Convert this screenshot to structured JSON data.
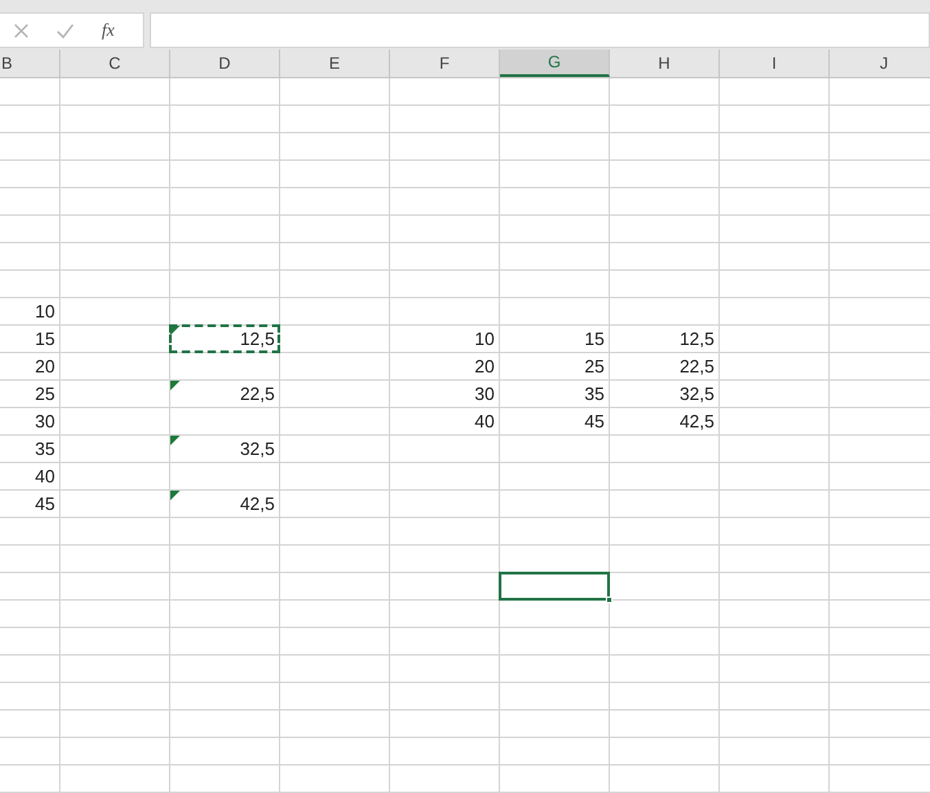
{
  "formula_bar": {
    "function_label": "fx"
  },
  "columns": [
    {
      "label": "B",
      "selected": false
    },
    {
      "label": "C",
      "selected": false
    },
    {
      "label": "D",
      "selected": false
    },
    {
      "label": "E",
      "selected": false
    },
    {
      "label": "F",
      "selected": false
    },
    {
      "label": "G",
      "selected": true
    },
    {
      "label": "H",
      "selected": false
    },
    {
      "label": "I",
      "selected": false
    },
    {
      "label": "J",
      "selected": false
    }
  ],
  "rows": [
    [
      {
        "selected": false
      },
      {
        "selected": false
      },
      {
        "selected": false
      },
      {
        "selected": false
      },
      {
        "selected": false
      },
      {
        "selected": false
      },
      {
        "selected": false
      },
      {
        "selected": false
      },
      {
        "selected": false
      }
    ],
    [
      {
        "selected": false
      },
      {
        "selected": false
      },
      {
        "selected": false
      },
      {
        "selected": false
      },
      {
        "selected": false
      },
      {
        "selected": false
      },
      {
        "selected": false
      },
      {
        "selected": false
      },
      {
        "selected": false
      }
    ],
    [
      {
        "selected": false
      },
      {
        "selected": false
      },
      {
        "selected": false
      },
      {
        "selected": false
      },
      {
        "selected": false
      },
      {
        "selected": false
      },
      {
        "selected": false
      },
      {
        "selected": false
      },
      {
        "selected": false
      }
    ],
    [
      {
        "selected": false
      },
      {
        "selected": false
      },
      {
        "selected": false
      },
      {
        "selected": false
      },
      {
        "selected": false
      },
      {
        "selected": false
      },
      {
        "selected": false
      },
      {
        "selected": false
      },
      {
        "selected": false
      }
    ],
    [
      {
        "selected": false
      },
      {
        "selected": false
      },
      {
        "selected": false
      },
      {
        "selected": false
      },
      {
        "selected": false
      },
      {
        "selected": false
      },
      {
        "selected": false
      },
      {
        "selected": false
      },
      {
        "selected": false
      }
    ],
    [
      {
        "selected": false
      },
      {
        "selected": false
      },
      {
        "selected": false
      },
      {
        "selected": false
      },
      {
        "selected": false
      },
      {
        "selected": false
      },
      {
        "selected": false
      },
      {
        "selected": false
      },
      {
        "selected": false
      }
    ],
    [
      {
        "selected": false
      },
      {
        "selected": false
      },
      {
        "selected": false
      },
      {
        "selected": false
      },
      {
        "selected": false
      },
      {
        "selected": false
      },
      {
        "selected": false
      },
      {
        "selected": false
      },
      {
        "selected": false
      }
    ],
    [
      {
        "selected": false
      },
      {
        "selected": false
      },
      {
        "selected": false
      },
      {
        "selected": false
      },
      {
        "selected": false
      },
      {
        "selected": false
      },
      {
        "selected": false
      },
      {
        "selected": false
      },
      {
        "selected": false
      }
    ],
    [
      {
        "selected": false,
        "value": "10"
      },
      {
        "selected": false
      },
      {
        "selected": false
      },
      {
        "selected": false
      },
      {
        "selected": false
      },
      {
        "selected": false
      },
      {
        "selected": false
      },
      {
        "selected": false
      },
      {
        "selected": false
      }
    ],
    [
      {
        "selected": false,
        "value": "15"
      },
      {
        "selected": false
      },
      {
        "selected": false,
        "value": "12,5",
        "error_flag": true,
        "copy_marquee": true
      },
      {
        "selected": false
      },
      {
        "selected": false,
        "value": "10"
      },
      {
        "selected": false,
        "value": "15"
      },
      {
        "selected": false,
        "value": "12,5"
      },
      {
        "selected": false
      },
      {
        "selected": false
      }
    ],
    [
      {
        "selected": false,
        "value": "20"
      },
      {
        "selected": false
      },
      {
        "selected": false
      },
      {
        "selected": false
      },
      {
        "selected": false,
        "value": "20"
      },
      {
        "selected": false,
        "value": "25"
      },
      {
        "selected": false,
        "value": "22,5"
      },
      {
        "selected": false
      },
      {
        "selected": false
      }
    ],
    [
      {
        "selected": false,
        "value": "25"
      },
      {
        "selected": false
      },
      {
        "selected": false,
        "value": "22,5",
        "error_flag": true
      },
      {
        "selected": false
      },
      {
        "selected": false,
        "value": "30"
      },
      {
        "selected": false,
        "value": "35"
      },
      {
        "selected": false,
        "value": "32,5"
      },
      {
        "selected": false
      },
      {
        "selected": false
      }
    ],
    [
      {
        "selected": false,
        "value": "30"
      },
      {
        "selected": false
      },
      {
        "selected": false
      },
      {
        "selected": false
      },
      {
        "selected": false,
        "value": "40"
      },
      {
        "selected": false,
        "value": "45"
      },
      {
        "selected": false,
        "value": "42,5"
      },
      {
        "selected": false
      },
      {
        "selected": false
      }
    ],
    [
      {
        "selected": false,
        "value": "35"
      },
      {
        "selected": false
      },
      {
        "selected": false,
        "value": "32,5",
        "error_flag": true
      },
      {
        "selected": false
      },
      {
        "selected": false
      },
      {
        "selected": false
      },
      {
        "selected": false
      },
      {
        "selected": false
      },
      {
        "selected": false
      }
    ],
    [
      {
        "selected": false,
        "value": "40"
      },
      {
        "selected": false
      },
      {
        "selected": false
      },
      {
        "selected": false
      },
      {
        "selected": false
      },
      {
        "selected": false
      },
      {
        "selected": false
      },
      {
        "selected": false
      },
      {
        "selected": false
      }
    ],
    [
      {
        "selected": false,
        "value": "45"
      },
      {
        "selected": false
      },
      {
        "selected": false,
        "value": "42,5",
        "error_flag": true
      },
      {
        "selected": false
      },
      {
        "selected": false
      },
      {
        "selected": false
      },
      {
        "selected": false
      },
      {
        "selected": false
      },
      {
        "selected": false
      }
    ],
    [
      {
        "selected": false
      },
      {
        "selected": false
      },
      {
        "selected": false
      },
      {
        "selected": false
      },
      {
        "selected": false
      },
      {
        "selected": false
      },
      {
        "selected": false
      },
      {
        "selected": false
      },
      {
        "selected": false
      }
    ],
    [
      {
        "selected": false
      },
      {
        "selected": false
      },
      {
        "selected": false
      },
      {
        "selected": false
      },
      {
        "selected": false
      },
      {
        "selected": false
      },
      {
        "selected": false
      },
      {
        "selected": false
      },
      {
        "selected": false
      }
    ],
    [
      {
        "selected": false
      },
      {
        "selected": false
      },
      {
        "selected": false
      },
      {
        "selected": false
      },
      {
        "selected": false
      },
      {
        "selected": true
      },
      {
        "selected": false
      },
      {
        "selected": false
      },
      {
        "selected": false
      }
    ],
    [
      {
        "selected": false
      },
      {
        "selected": false
      },
      {
        "selected": false
      },
      {
        "selected": false
      },
      {
        "selected": false
      },
      {
        "selected": false
      },
      {
        "selected": false
      },
      {
        "selected": false
      },
      {
        "selected": false
      }
    ],
    [
      {
        "selected": false
      },
      {
        "selected": false
      },
      {
        "selected": false
      },
      {
        "selected": false
      },
      {
        "selected": false
      },
      {
        "selected": false
      },
      {
        "selected": false
      },
      {
        "selected": false
      },
      {
        "selected": false
      }
    ],
    [
      {
        "selected": false
      },
      {
        "selected": false
      },
      {
        "selected": false
      },
      {
        "selected": false
      },
      {
        "selected": false
      },
      {
        "selected": false
      },
      {
        "selected": false
      },
      {
        "selected": false
      },
      {
        "selected": false
      }
    ],
    [
      {
        "selected": false
      },
      {
        "selected": false
      },
      {
        "selected": false
      },
      {
        "selected": false
      },
      {
        "selected": false
      },
      {
        "selected": false
      },
      {
        "selected": false
      },
      {
        "selected": false
      },
      {
        "selected": false
      }
    ],
    [
      {
        "selected": false
      },
      {
        "selected": false
      },
      {
        "selected": false
      },
      {
        "selected": false
      },
      {
        "selected": false
      },
      {
        "selected": false
      },
      {
        "selected": false
      },
      {
        "selected": false
      },
      {
        "selected": false
      }
    ],
    [
      {
        "selected": false
      },
      {
        "selected": false
      },
      {
        "selected": false
      },
      {
        "selected": false
      },
      {
        "selected": false
      },
      {
        "selected": false
      },
      {
        "selected": false
      },
      {
        "selected": false
      },
      {
        "selected": false
      }
    ],
    [
      {
        "selected": false
      },
      {
        "selected": false
      },
      {
        "selected": false
      },
      {
        "selected": false
      },
      {
        "selected": false
      },
      {
        "selected": false
      },
      {
        "selected": false
      },
      {
        "selected": false
      },
      {
        "selected": false
      }
    ]
  ]
}
